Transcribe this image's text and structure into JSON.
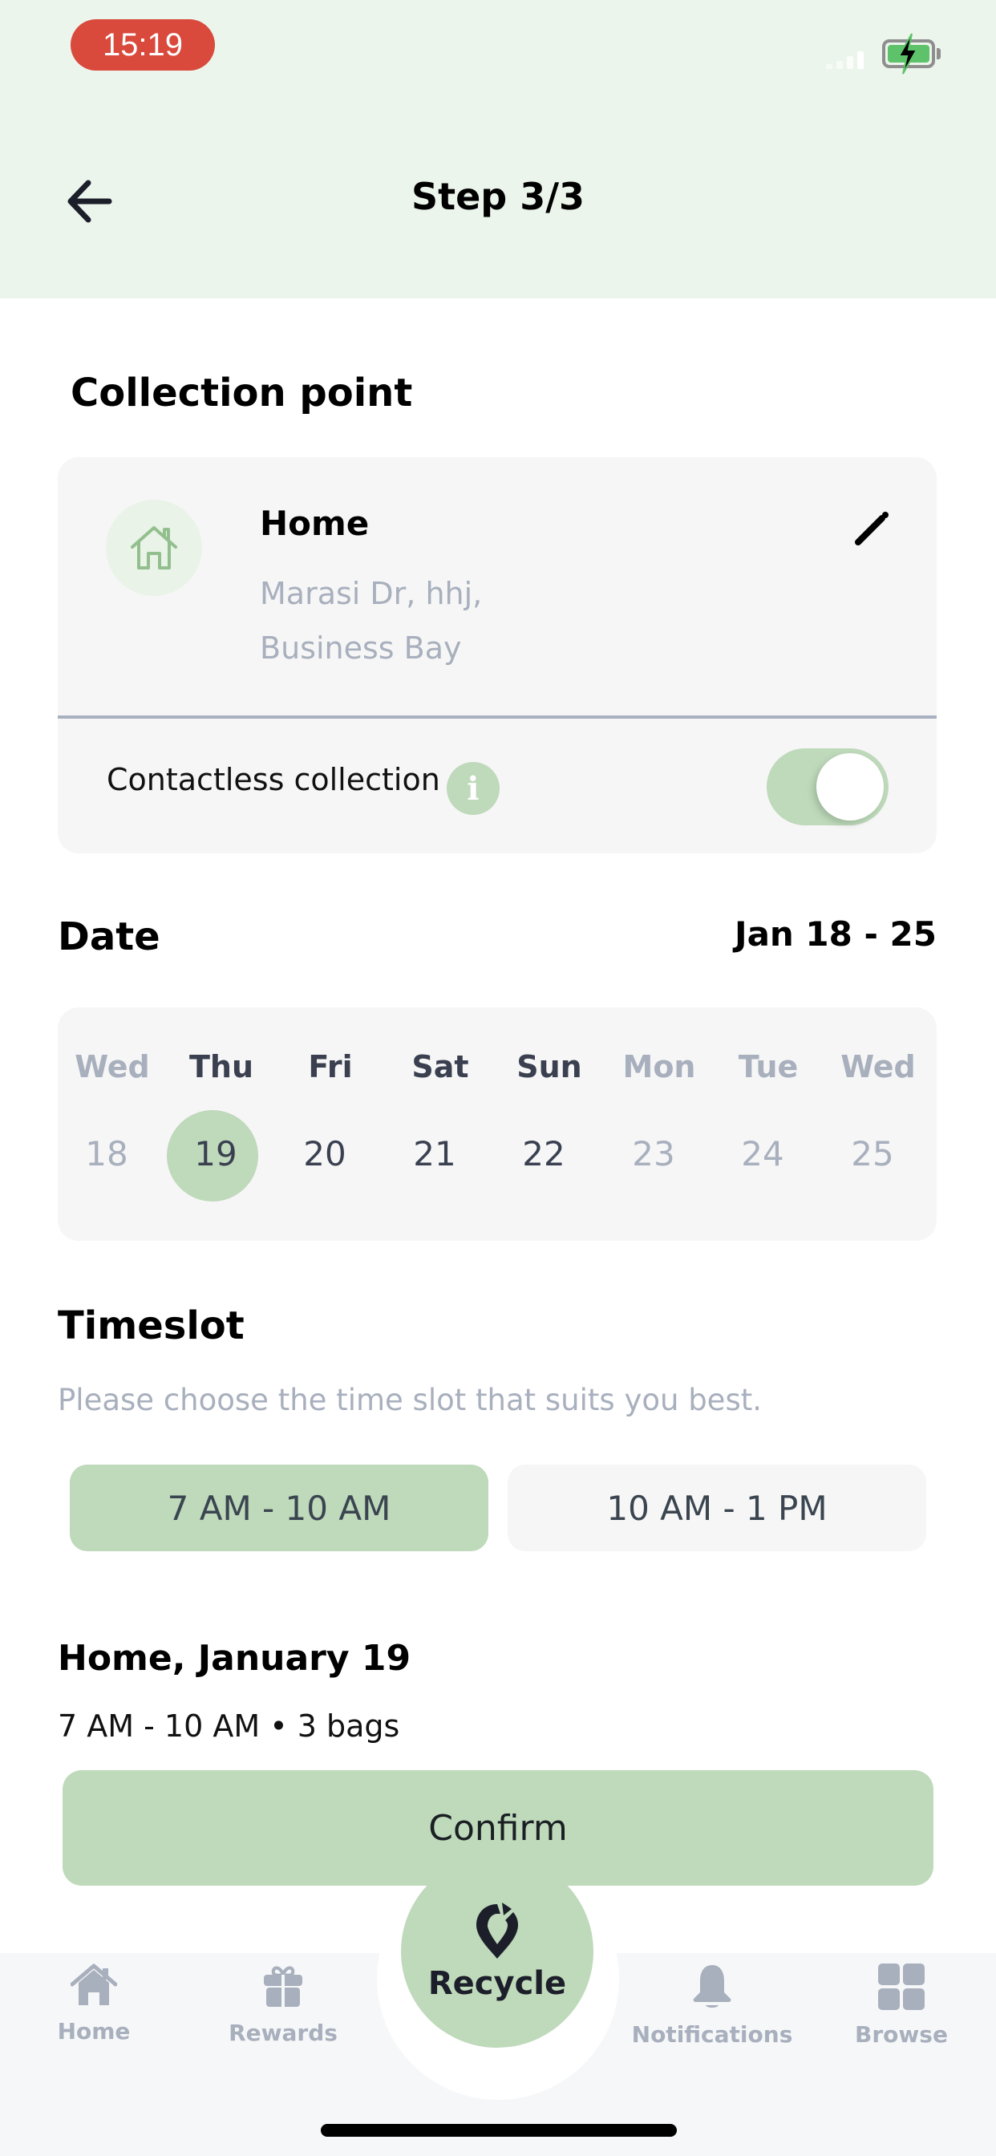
{
  "status_bar": {
    "time": "15:19",
    "icons": [
      "signal-icon",
      "battery-charging-icon"
    ]
  },
  "header": {
    "back_icon": "arrow-left-icon",
    "title": "Step 3/3"
  },
  "collection_point": {
    "heading": "Collection point",
    "location_icon": "home-outline-icon",
    "name": "Home",
    "address_lines": [
      "Marasi Dr, hhj,",
      "Business Bay"
    ],
    "edit_icon": "pencil-icon",
    "contactless_label": "Contactless collection",
    "info_icon": "info-icon",
    "contactless_enabled": true
  },
  "date": {
    "heading": "Date",
    "range": "Jan 18 - 25",
    "days": [
      {
        "weekday": "Wed",
        "date": "18",
        "available": false,
        "selected": false
      },
      {
        "weekday": "Thu",
        "date": "19",
        "available": true,
        "selected": true
      },
      {
        "weekday": "Fri",
        "date": "20",
        "available": true,
        "selected": false
      },
      {
        "weekday": "Sat",
        "date": "21",
        "available": true,
        "selected": false
      },
      {
        "weekday": "Sun",
        "date": "22",
        "available": true,
        "selected": false
      },
      {
        "weekday": "Mon",
        "date": "23",
        "available": false,
        "selected": false
      },
      {
        "weekday": "Tue",
        "date": "24",
        "available": false,
        "selected": false
      },
      {
        "weekday": "Wed",
        "date": "25",
        "available": false,
        "selected": false
      }
    ]
  },
  "timeslot": {
    "heading": "Timeslot",
    "subtitle": "Please choose the time slot that suits you best.",
    "options": [
      {
        "label": "7 AM - 10 AM",
        "selected": true
      },
      {
        "label": "10 AM - 1 PM",
        "selected": false
      }
    ]
  },
  "summary": {
    "title": "Home, January 19",
    "detail": "7 AM - 10 AM • 3 bags"
  },
  "confirm_label": "Confirm",
  "bottom_nav": {
    "items": [
      {
        "label": "Home",
        "icon": "home-icon"
      },
      {
        "label": "Rewards",
        "icon": "gift-icon"
      },
      {
        "label": "Recycle",
        "icon": "recycle-pin-icon",
        "active": true
      },
      {
        "label": "Notifications",
        "icon": "bell-icon"
      },
      {
        "label": "Browse",
        "icon": "grid-icon"
      }
    ]
  },
  "colors": {
    "accent": "#bfd9bb",
    "header_bg": "#ecf5ec",
    "muted_text": "#a8afbd",
    "time_pill": "#d9493c"
  }
}
